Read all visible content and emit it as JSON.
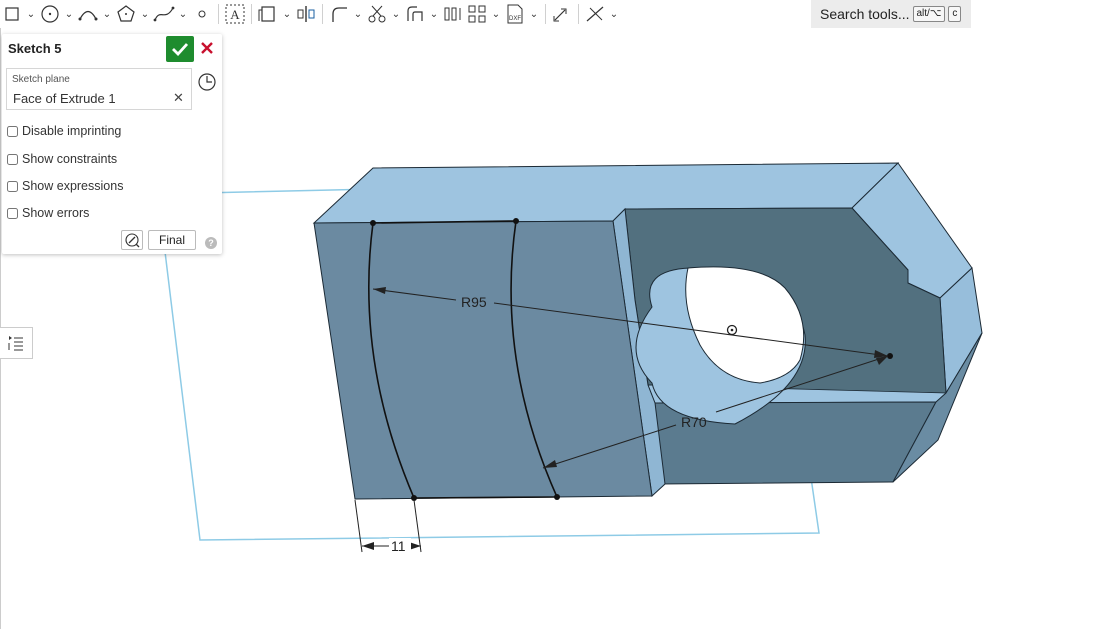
{
  "toolbar": {
    "search_label": "Search tools...",
    "shortcut_key1": "alt/⌥",
    "shortcut_key2": "c"
  },
  "panel": {
    "title": "Sketch 5",
    "sketch_plane_label": "Sketch plane",
    "sketch_plane_value": "Face of Extrude 1",
    "options": [
      {
        "label": "Disable imprinting",
        "checked": false
      },
      {
        "label": "Show constraints",
        "checked": false
      },
      {
        "label": "Show expressions",
        "checked": false
      },
      {
        "label": "Show errors",
        "checked": false
      }
    ],
    "final_label": "Final",
    "help_label": "?"
  },
  "dimensions": {
    "radius_outer": "R95",
    "radius_inner": "R70",
    "width": "11"
  },
  "colors": {
    "accept": "#1e8c2e",
    "cancel": "#c8102e",
    "face_front": "#6b8aa1",
    "face_top": "#9ec4e0",
    "sketch_plane": "#8ecbe6"
  }
}
